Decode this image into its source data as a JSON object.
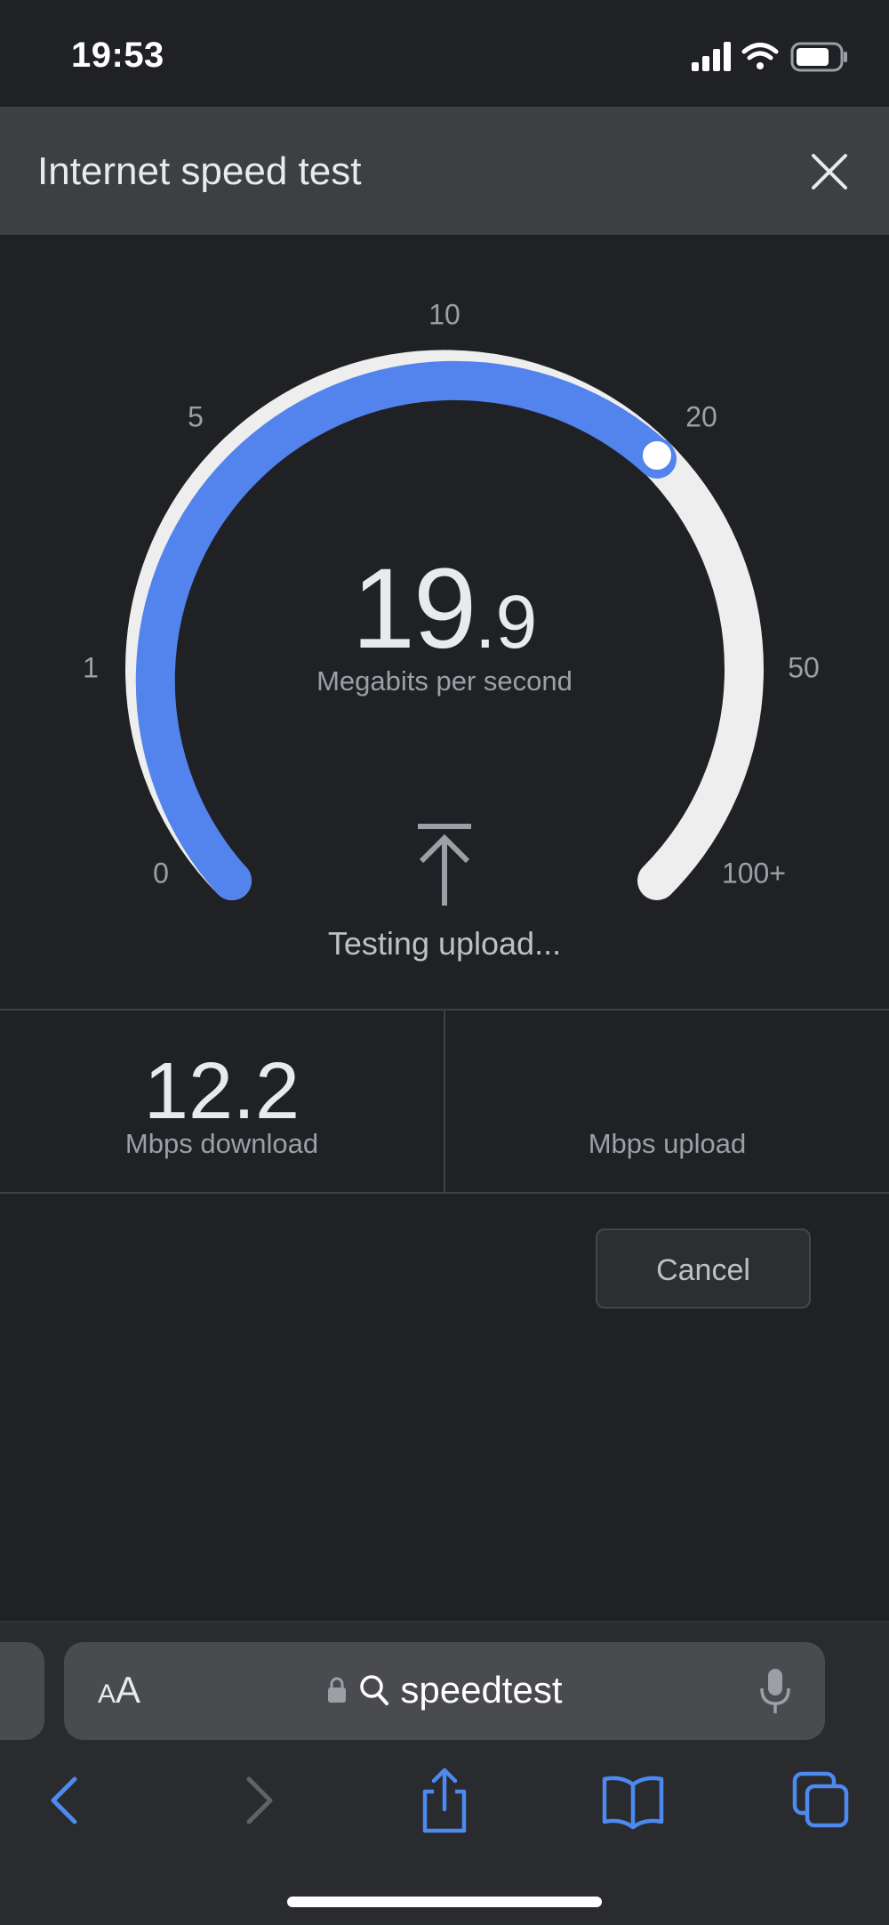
{
  "status_bar": {
    "time": "19:53"
  },
  "header": {
    "title": "Internet speed test"
  },
  "gauge": {
    "scale_labels": [
      "0",
      "1",
      "5",
      "10",
      "20",
      "50",
      "100+"
    ],
    "current_value": 19.9,
    "current_int": "19",
    "current_dec": ".9",
    "unit": "Megabits per second",
    "status": "Testing upload...",
    "progress_color": "#5383ec",
    "track_color": "#eeeeee"
  },
  "results": {
    "download_value": "12.2",
    "download_label": "Mbps download",
    "upload_value": "",
    "upload_label": "Mbps upload"
  },
  "actions": {
    "cancel_label": "Cancel"
  },
  "browser": {
    "text_size_small": "A",
    "text_size_big": "A",
    "address": "speedtest",
    "accent_color": "#4d8af0"
  }
}
